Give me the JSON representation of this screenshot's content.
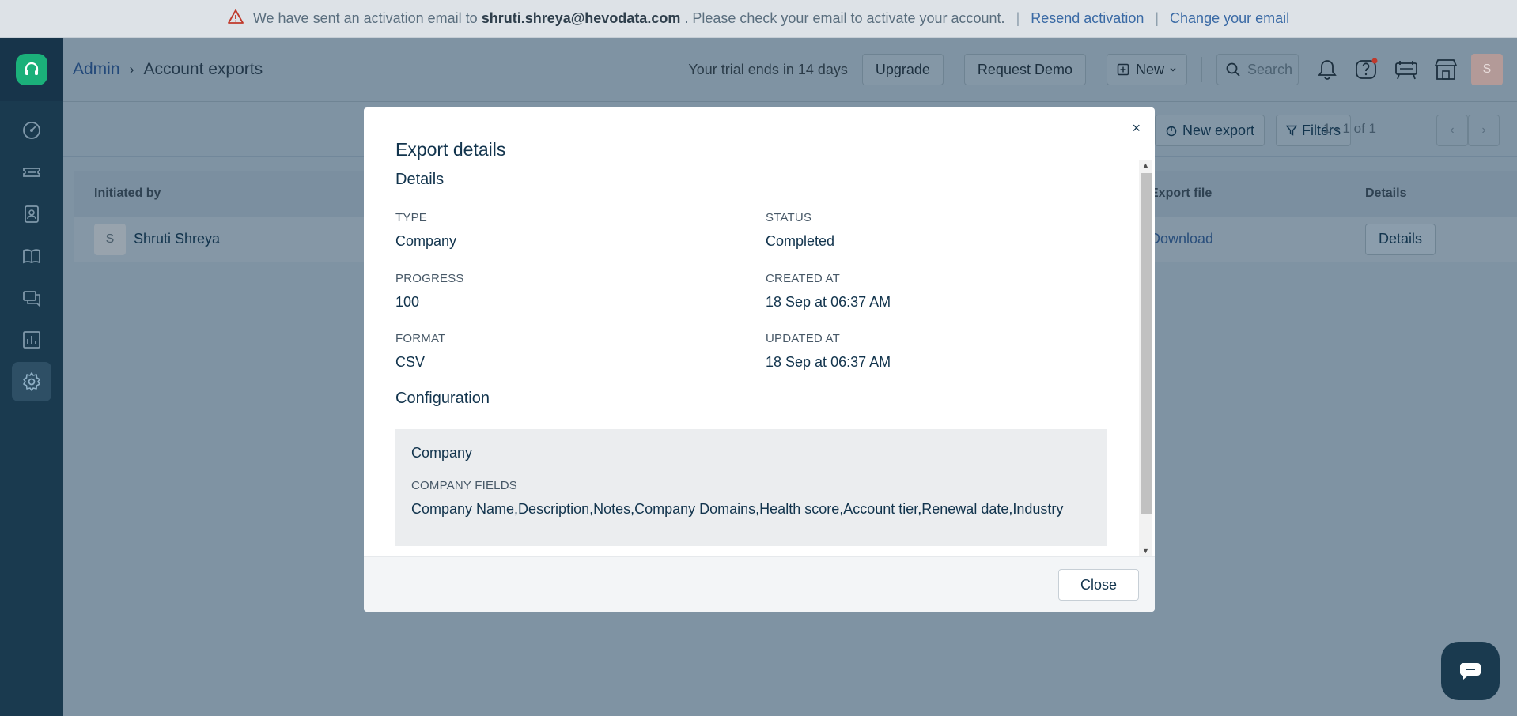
{
  "banner": {
    "text_prefix": "We have sent an activation email to",
    "email": "shruti.shreya@hevodata.com",
    "text_suffix": ". Please check your email to activate your account.",
    "resend": "Resend activation",
    "change": "Change your email",
    "separator": "|"
  },
  "header": {
    "crumb_admin": "Admin",
    "crumb_chevron": "›",
    "crumb_page": "Account exports",
    "trial": "Your trial ends in 14 days",
    "upgrade": "Upgrade",
    "request_demo": "Request Demo",
    "new_label": "New",
    "search_placeholder": "Search",
    "avatar_initial": "S"
  },
  "toolbar": {
    "new_export": "New export",
    "filters": "Filters",
    "pager": "1 - 1 of 1"
  },
  "table": {
    "headers": {
      "initiated_by": "Initiated by",
      "export_file": "Export file",
      "details": "Details"
    },
    "row": {
      "avatar": "S",
      "name": "Shruti Shreya",
      "download": "Download",
      "details_btn": "Details"
    }
  },
  "modal": {
    "title": "Export details",
    "close_x": "×",
    "details_heading": "Details",
    "fields": {
      "type_label": "TYPE",
      "type_value": "Company",
      "status_label": "STATUS",
      "status_value": "Completed",
      "progress_label": "PROGRESS",
      "progress_value": "100",
      "created_label": "CREATED AT",
      "created_value": "18 Sep at 06:37 AM",
      "format_label": "FORMAT",
      "format_value": "CSV",
      "updated_label": "UPDATED AT",
      "updated_value": "18 Sep at 06:37 AM"
    },
    "configuration_heading": "Configuration",
    "config": {
      "entity": "Company",
      "fields_label": "COMPANY FIELDS",
      "fields_value": "Company Name,Description,Notes,Company Domains,Health score,Account tier,Renewal date,Industry"
    },
    "close_button": "Close"
  },
  "colors": {
    "sidebar": "#1a3a4f",
    "brand_green": "#1bb07a",
    "overlay": "#7f93a3",
    "link": "#3a6aa5"
  }
}
